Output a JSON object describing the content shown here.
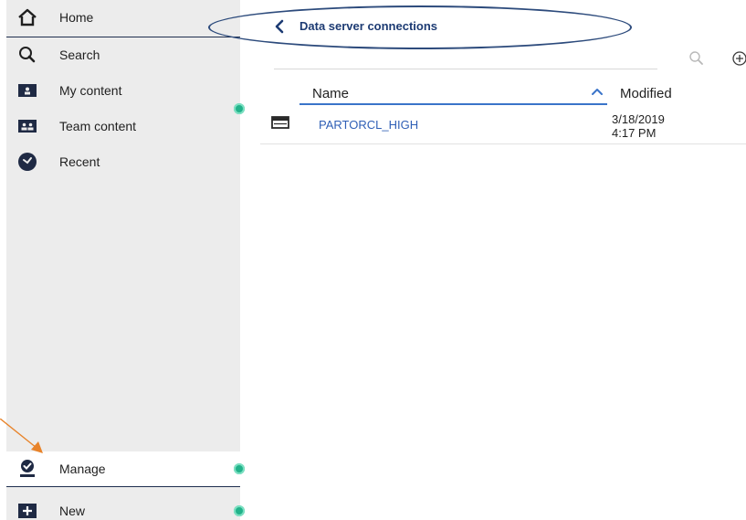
{
  "sidebar": {
    "items": [
      {
        "label": "Home",
        "icon": "home-icon"
      },
      {
        "label": "Search",
        "icon": "search-icon"
      },
      {
        "label": "My content",
        "icon": "folder-user-icon"
      },
      {
        "label": "Team content",
        "icon": "folder-team-icon"
      },
      {
        "label": "Recent",
        "icon": "clock-icon"
      }
    ],
    "bottom": [
      {
        "label": "Manage",
        "icon": "manage-icon"
      },
      {
        "label": "New",
        "icon": "plus-icon"
      }
    ]
  },
  "main": {
    "breadcrumb": {
      "title": "Data server connections",
      "back_icon": "chevron-left-icon"
    },
    "toolbar": {
      "search_icon": "search-icon",
      "add_icon": "add-circle-icon"
    },
    "table": {
      "columns": [
        "Name",
        "Modified"
      ],
      "sort_icon": "chevron-up-icon",
      "rows": [
        {
          "name": "PARTORCL_HIGH",
          "modified_date": "3/18/2019",
          "modified_time": "4:17 PM",
          "icon": "data-server-icon"
        }
      ]
    }
  },
  "colors": {
    "sidebar_bg": "#ececec",
    "accent_blue": "#2f5fb6",
    "status_dot": "#22b28a",
    "annotation_orange": "#e8832a",
    "annotation_oval": "#2d4b7c"
  }
}
